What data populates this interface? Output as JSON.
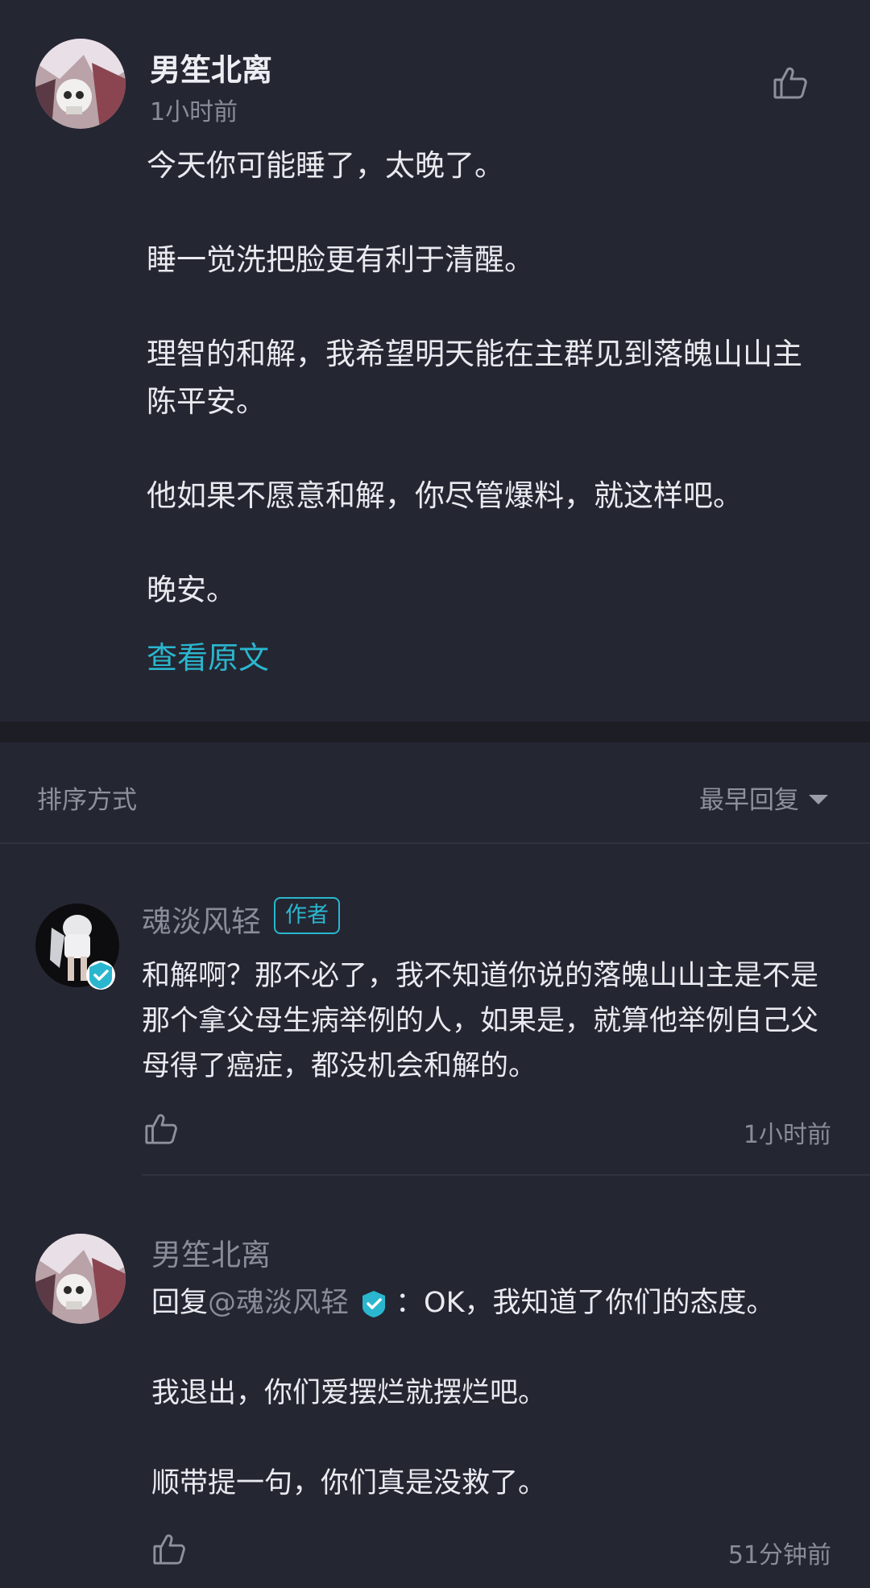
{
  "main_post": {
    "author": "男笙北离",
    "time": "1小时前",
    "paragraphs": [
      "今天你可能睡了，太晚了。",
      "睡一觉洗把脸更有利于清醒。",
      "理智的和解，我希望明天能在主群见到落魄山山主陈平安。",
      "他如果不愿意和解，你尽管爆料，就这样吧。",
      "晚安。"
    ],
    "view_original": "查看原文"
  },
  "sort": {
    "label": "排序方式",
    "value": "最早回复"
  },
  "comments": [
    {
      "author": "魂淡风轻",
      "tag": "作者",
      "body": "和解啊？那不必了，我不知道你说的落魄山山主是不是那个拿父母生病举例的人，如果是，就算他举例自己父母得了癌症，都没机会和解的。",
      "time": "1小时前"
    },
    {
      "author": "男笙北离",
      "reply_prefix": "回复",
      "reply_to": "@魂淡风轻",
      "reply_text": "：OK，我知道了你们的态度。",
      "paragraphs": [
        "我退出，你们爱摆烂就摆烂吧。",
        "顺带提一句，你们真是没救了。"
      ],
      "time": "51分钟前"
    }
  ],
  "colors": {
    "background": "#242631",
    "accent": "#2bb6cf",
    "muted_text": "#8a8d99",
    "body_text": "#e9eaef"
  },
  "icons": [
    "thumbs-up-icon",
    "verified-badge-icon",
    "caret-down-icon"
  ]
}
